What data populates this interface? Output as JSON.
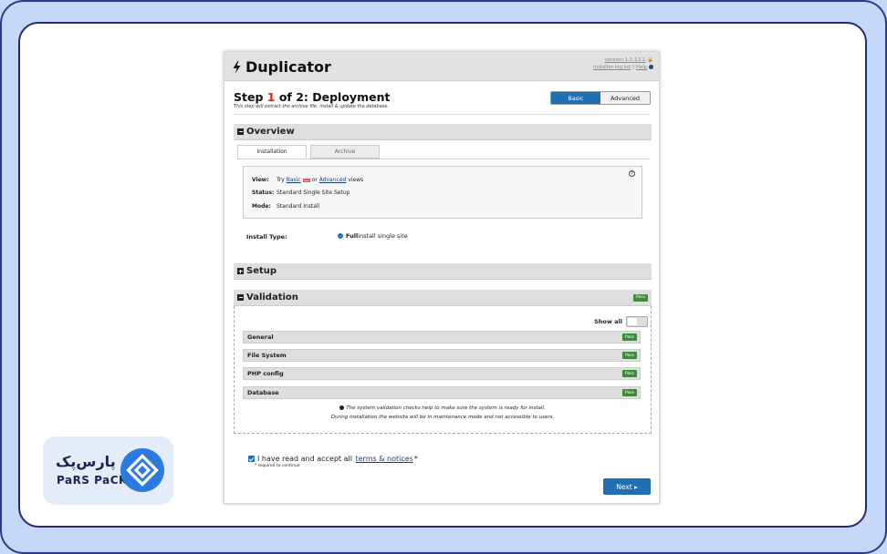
{
  "header": {
    "brand": "Duplicator",
    "version": "version:1.5.13.1",
    "log_link": "installer-log.txt",
    "help_link": "Help"
  },
  "step": {
    "prefix": "Step ",
    "number": "1",
    "suffix": " of 2: Deployment",
    "subtitle": "This step will extract the archive file, install & update the database.",
    "mode_basic": "Basic",
    "mode_advanced": "Advanced"
  },
  "overview": {
    "title": "Overview",
    "tabs": [
      "Installation",
      "Archive"
    ],
    "rows": [
      {
        "key": "View:",
        "pre": "Try ",
        "link1": "Basic",
        "badge": "new",
        "mid": " or ",
        "link2": "Advanced",
        "post": " views"
      },
      {
        "key": "Status:",
        "value": "Standard Single Site Setup"
      },
      {
        "key": "Mode:",
        "value": "Standard Install"
      }
    ],
    "install_type_label": "Install Type:",
    "install_type_bold": "Full",
    "install_type_rest": " install single site"
  },
  "setup": {
    "title": "Setup"
  },
  "validation": {
    "title": "Validation",
    "status": "Pass",
    "show_all": "Show all",
    "items": [
      {
        "label": "General",
        "status": "Pass"
      },
      {
        "label": "File System",
        "status": "Pass"
      },
      {
        "label": "PHP config",
        "status": "Pass"
      },
      {
        "label": "Database",
        "status": "Pass"
      }
    ],
    "note_1": "The system validation checks help to make sure the system is ready for install.",
    "note_2": "During installation the website will be in maintenance mode and not accessible to users."
  },
  "footer": {
    "accept_pre": "I have read and accept all",
    "accept_link": "terms & notices",
    "accept_post": "*",
    "required": "* required to continue",
    "next": "Next ▸"
  },
  "brand_logo": {
    "fa": "پارس‌پک",
    "en": "PaRS PaCK"
  },
  "colors": {
    "accent": "#1f6fb5",
    "pass": "#3e8c3b",
    "step_number": "#d0281c",
    "page_bg": "#c5d8f7",
    "frame_border": "#232a7a"
  }
}
